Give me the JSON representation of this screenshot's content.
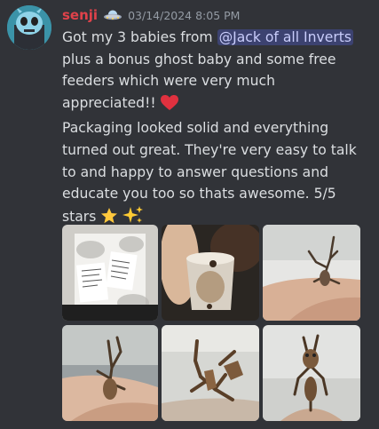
{
  "message": {
    "username": "senji",
    "badge_icon": "ufo-icon",
    "timestamp": "03/14/2024 8:05 PM",
    "text_before_mention": "Got my 3 babies from ",
    "mention": "@Jack of all Inverts",
    "text_after_mention": " plus a bonus ghost baby and some free feeders which were very much appreciated!! ",
    "heart_emoji": "❤️",
    "line2": "Packaging looked solid and everything turned out great. They're very easy to talk to and happy to answer questions and educate you too so thats awesome. 5/5 stars ",
    "star_emoji": "⭐",
    "sparkles_emoji": "✨",
    "attachments": [
      {
        "icon": "photo-packaging"
      },
      {
        "icon": "photo-cup"
      },
      {
        "icon": "photo-mantis-finger"
      },
      {
        "icon": "photo-mantis-hand"
      },
      {
        "icon": "photo-ghost-mantis"
      },
      {
        "icon": "photo-mantis-closeup"
      }
    ]
  },
  "colors": {
    "background": "#313338",
    "username": "#e0424a",
    "mention_bg": "#3c4270",
    "text": "#dbdee1",
    "timestamp": "#949ba4"
  }
}
